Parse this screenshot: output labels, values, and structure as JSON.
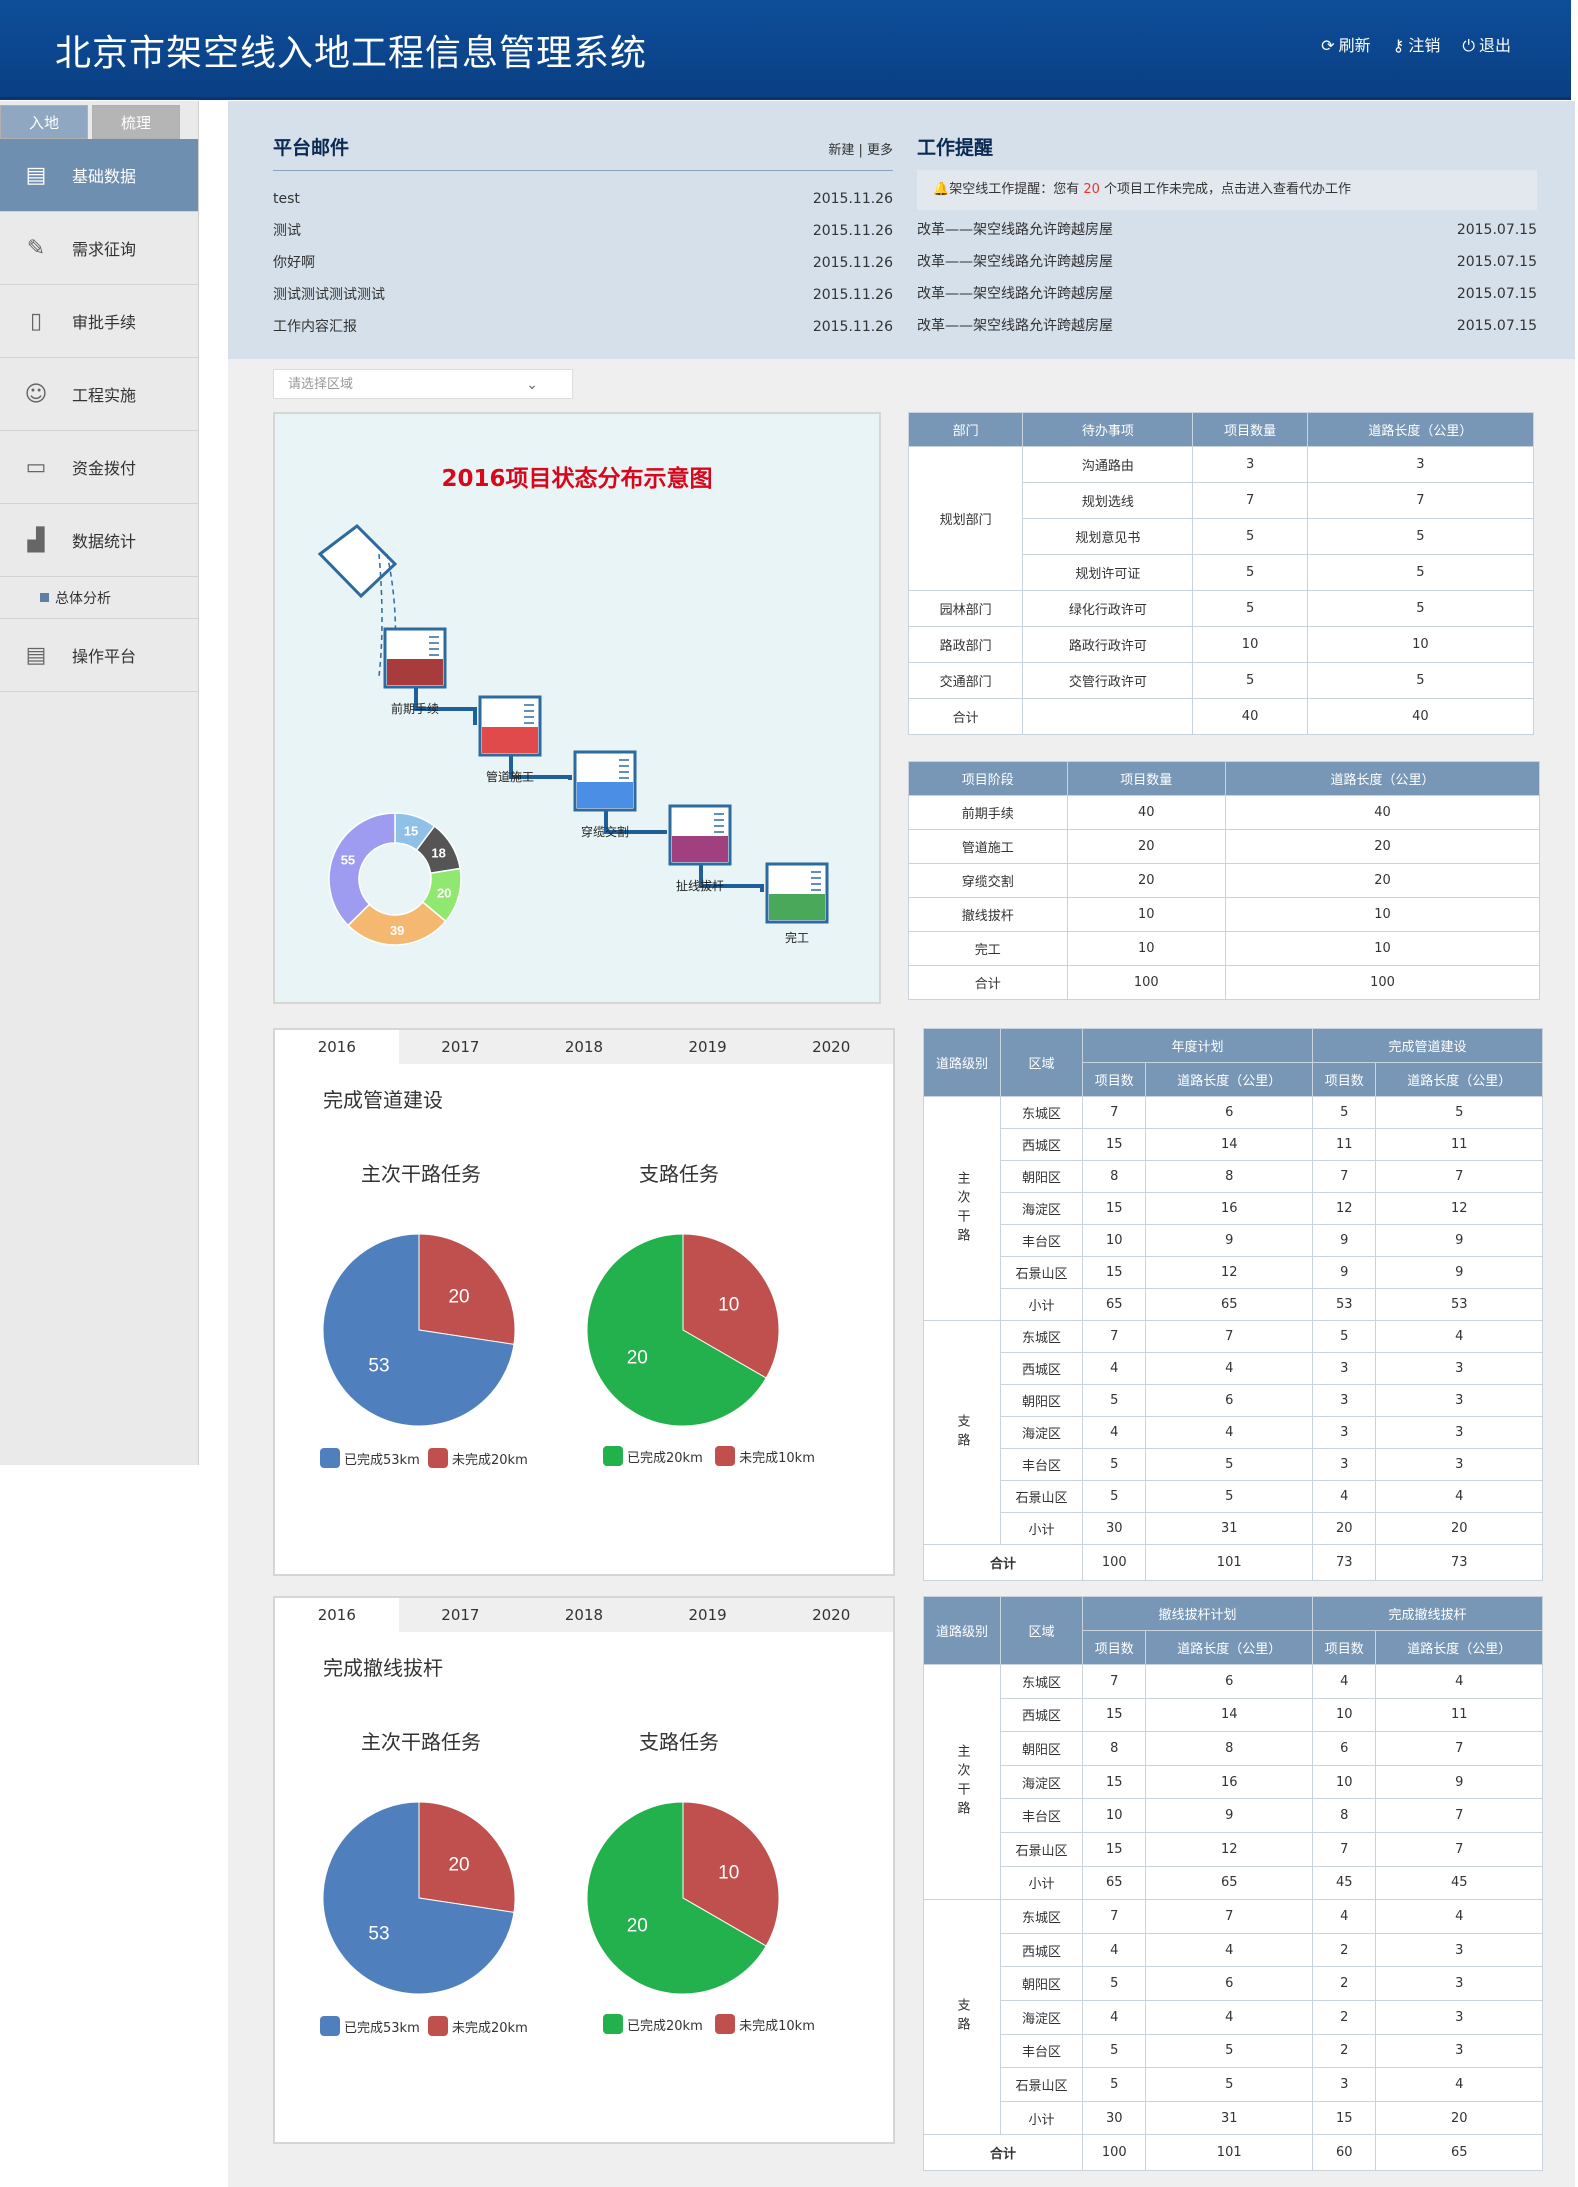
{
  "app": {
    "title": "北京市架空线入地工程信息管理系统",
    "refresh": "刷新",
    "logout_label": "注销",
    "exit": "退出"
  },
  "sidebar": {
    "tabs": [
      "入地",
      "梳理"
    ],
    "items": [
      "基础数据",
      "需求征询",
      "审批手续",
      "工程实施",
      "资金拨付",
      "数据统计"
    ],
    "sub": "总体分析",
    "last": "操作平台"
  },
  "mail": {
    "title": "平台邮件",
    "links": "新建 | 更多",
    "rows": [
      [
        "test",
        "2015.11.26"
      ],
      [
        "测试",
        "2015.11.26"
      ],
      [
        "你好啊",
        "2015.11.26"
      ],
      [
        "测试测试测试测试",
        "2015.11.26"
      ],
      [
        "工作内容汇报",
        "2015.11.26"
      ]
    ]
  },
  "work": {
    "title": "工作提醒",
    "alert_pre": "架空线工作提醒：您有",
    "alert_num": "20",
    "alert_post": "个项目工作未完成，点击进入查看代办工作",
    "rows": [
      [
        "改革——架空线路允许跨越房屋",
        "2015.07.15"
      ],
      [
        "改革——架空线路允许跨越房屋",
        "2015.07.15"
      ],
      [
        "改革——架空线路允许跨越房屋",
        "2015.07.15"
      ],
      [
        "改革——架空线路允许跨越房屋",
        "2015.07.15"
      ]
    ]
  },
  "area_select": "请选择区域",
  "flow": {
    "title": "2016项目状态分布示意图",
    "stages": [
      "前期手续",
      "管道施工",
      "穿缆交割",
      "扯线拔杆",
      "完工"
    ],
    "donut": [
      15,
      18,
      20,
      39,
      55
    ]
  },
  "years": [
    "2016",
    "2017",
    "2018",
    "2019",
    "2020"
  ],
  "panel1": {
    "title": "完成管道建设",
    "left": "主次干路任务",
    "right": "支路任务",
    "leg": [
      "已完成53km",
      "未完成20km",
      "已完成20km",
      "未完成10km"
    ]
  },
  "panel2": {
    "title": "完成撤线拔杆",
    "left": "主次干路任务",
    "right": "支路任务",
    "leg": [
      "已完成53km",
      "未完成20km",
      "已完成20km",
      "未完成10km"
    ]
  },
  "chart_data": [
    {
      "type": "pie",
      "title": "主次干路任务",
      "categories": [
        "已完成53km",
        "未完成20km"
      ],
      "values": [
        53,
        20
      ],
      "colors": [
        "#4f7fbd",
        "#c0504d"
      ]
    },
    {
      "type": "pie",
      "title": "支路任务",
      "categories": [
        "已完成20km",
        "未完成10km"
      ],
      "values": [
        20,
        10
      ],
      "colors": [
        "#22b14c",
        "#c0504d"
      ]
    },
    {
      "type": "pie",
      "title": "主次干路任务",
      "categories": [
        "已完成53km",
        "未完成20km"
      ],
      "values": [
        53,
        20
      ],
      "colors": [
        "#4f7fbd",
        "#c0504d"
      ]
    },
    {
      "type": "pie",
      "title": "支路任务",
      "categories": [
        "已完成20km",
        "未完成10km"
      ],
      "values": [
        20,
        10
      ],
      "colors": [
        "#22b14c",
        "#c0504d"
      ]
    },
    {
      "type": "pie",
      "title": "",
      "values": [
        15,
        18,
        20,
        39,
        55
      ],
      "colors": [
        "#8fc0e8",
        "#555555",
        "#90e870",
        "#f4b870",
        "#9e9cf0"
      ]
    }
  ],
  "t1": {
    "head": [
      "部门",
      "待办事项",
      "项目数量",
      "道路长度（公里）"
    ],
    "rows": [
      [
        "规划部门",
        "沟通路由",
        "3",
        "3"
      ],
      [
        "",
        "规划选线",
        "7",
        "7"
      ],
      [
        "",
        "规划意见书",
        "5",
        "5"
      ],
      [
        "",
        "规划许可证",
        "5",
        "5"
      ],
      [
        "园林部门",
        "绿化行政许可",
        "5",
        "5"
      ],
      [
        "路政部门",
        "路政行政许可",
        "10",
        "10"
      ],
      [
        "交通部门",
        "交管行政许可",
        "5",
        "5"
      ],
      [
        "合计",
        "",
        "40",
        "40"
      ]
    ]
  },
  "t2": {
    "head": [
      "项目阶段",
      "项目数量",
      "道路长度（公里）"
    ],
    "rows": [
      [
        "前期手续",
        "40",
        "40"
      ],
      [
        "管道施工",
        "20",
        "20"
      ],
      [
        "穿缆交割",
        "20",
        "20"
      ],
      [
        "撤线拔杆",
        "10",
        "10"
      ],
      [
        "完工",
        "10",
        "10"
      ],
      [
        "合计",
        "100",
        "100"
      ]
    ]
  },
  "t3": {
    "h1": [
      "道路级别",
      "区域",
      "年度计划",
      "完成管道建设"
    ],
    "h2": [
      "项目数",
      "道路长度（公里）",
      "项目数",
      "道路长度（公里）"
    ],
    "g1": "主次干路",
    "g2": "支路",
    "total": "合计",
    "rows1": [
      [
        "东城区",
        "7",
        "6",
        "5",
        "5"
      ],
      [
        "西城区",
        "15",
        "14",
        "11",
        "11"
      ],
      [
        "朝阳区",
        "8",
        "8",
        "7",
        "7"
      ],
      [
        "海淀区",
        "15",
        "16",
        "12",
        "12"
      ],
      [
        "丰台区",
        "10",
        "9",
        "9",
        "9"
      ],
      [
        "石景山区",
        "15",
        "12",
        "9",
        "9"
      ],
      [
        "小计",
        "65",
        "65",
        "53",
        "53"
      ]
    ],
    "rows2": [
      [
        "东城区",
        "7",
        "7",
        "5",
        "4"
      ],
      [
        "西城区",
        "4",
        "4",
        "3",
        "3"
      ],
      [
        "朝阳区",
        "5",
        "6",
        "3",
        "3"
      ],
      [
        "海淀区",
        "4",
        "4",
        "3",
        "3"
      ],
      [
        "丰台区",
        "5",
        "5",
        "3",
        "3"
      ],
      [
        "石景山区",
        "5",
        "5",
        "4",
        "4"
      ],
      [
        "小计",
        "30",
        "31",
        "20",
        "20"
      ]
    ],
    "sum": [
      "100",
      "101",
      "73",
      "73"
    ]
  },
  "t4": {
    "h1": [
      "道路级别",
      "区域",
      "撤线拔杆计划",
      "完成撤线拔杆"
    ],
    "h2": [
      "项目数",
      "道路长度（公里）",
      "项目数",
      "道路长度（公里）"
    ],
    "g1": "主次干路",
    "g2": "支路",
    "total": "合计",
    "rows1": [
      [
        "东城区",
        "7",
        "6",
        "4",
        "4"
      ],
      [
        "西城区",
        "15",
        "14",
        "10",
        "11"
      ],
      [
        "朝阳区",
        "8",
        "8",
        "6",
        "7"
      ],
      [
        "海淀区",
        "15",
        "16",
        "10",
        "9"
      ],
      [
        "丰台区",
        "10",
        "9",
        "8",
        "7"
      ],
      [
        "石景山区",
        "15",
        "12",
        "7",
        "7"
      ],
      [
        "小计",
        "65",
        "65",
        "45",
        "45"
      ]
    ],
    "rows2": [
      [
        "东城区",
        "7",
        "7",
        "4",
        "4"
      ],
      [
        "西城区",
        "4",
        "4",
        "2",
        "3"
      ],
      [
        "朝阳区",
        "5",
        "6",
        "2",
        "3"
      ],
      [
        "海淀区",
        "4",
        "4",
        "2",
        "3"
      ],
      [
        "丰台区",
        "5",
        "5",
        "2",
        "3"
      ],
      [
        "石景山区",
        "5",
        "5",
        "3",
        "4"
      ],
      [
        "小计",
        "30",
        "31",
        "15",
        "20"
      ]
    ],
    "sum": [
      "100",
      "101",
      "60",
      "65"
    ]
  }
}
